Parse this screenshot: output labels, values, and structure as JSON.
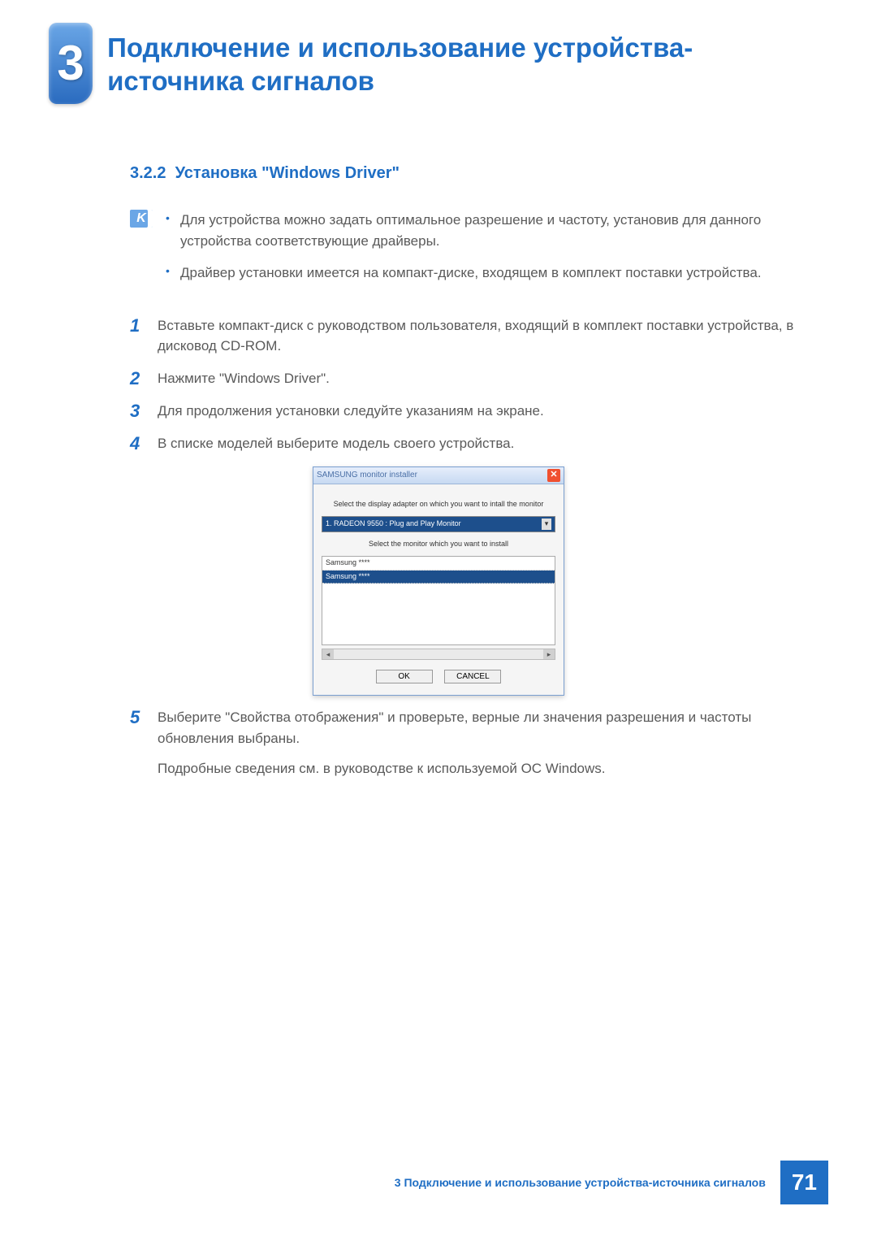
{
  "chapter": {
    "number": "3",
    "title": "Подключение и использование устройства-источника сигналов"
  },
  "section": {
    "number": "3.2.2",
    "title": "Установка \"Windows Driver\""
  },
  "notes": [
    "Для устройства можно задать оптимальное разрешение и частоту, установив для данного устройства соответствующие драйверы.",
    "Драйвер установки имеется на компакт-диске, входящем в комплект поставки устройства."
  ],
  "steps": {
    "s1": "Вставьте компакт-диск с руководством пользователя, входящий в комплект поставки устройства, в дисковод CD-ROM.",
    "s2": "Нажмите \"Windows Driver\".",
    "s3": "Для продолжения установки следуйте указаниям на экране.",
    "s4": "В списке моделей выберите модель своего устройства.",
    "s5a": "Выберите \"Свойства отображения\" и проверьте, верные ли значения разрешения и частоты обновления выбраны.",
    "s5b": "Подробные сведения см. в руководстве к используемой ОС Windows."
  },
  "installer": {
    "window_title": "SAMSUNG monitor installer",
    "label_adapter": "Select the display adapter on which you want to intall the monitor",
    "adapter_selected": "1. RADEON 9550 : Plug and Play Monitor",
    "label_monitor": "Select the monitor which you want to install",
    "monitors": [
      "Samsung ****",
      "Samsung ****"
    ],
    "ok_label": "OK",
    "cancel_label": "CANCEL"
  },
  "footer": {
    "text": "3 Подключение и использование устройства-источника сигналов",
    "page": "71"
  }
}
